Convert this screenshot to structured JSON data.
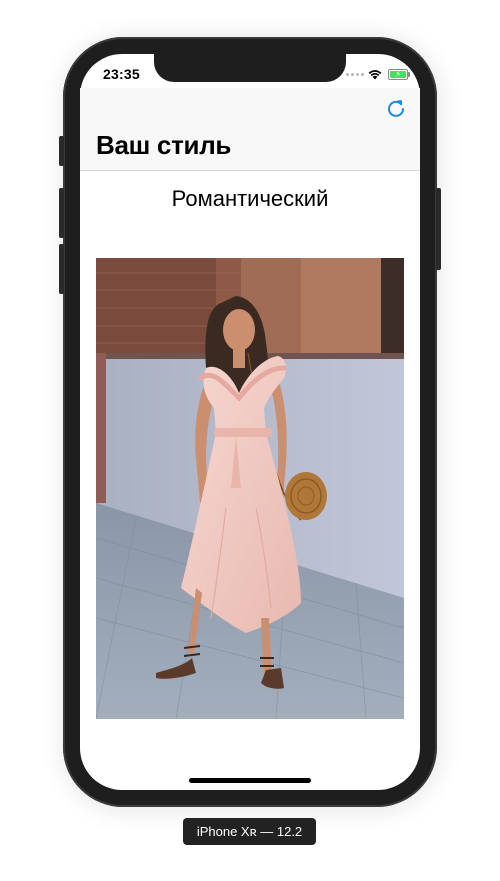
{
  "status_bar": {
    "time": "23:35"
  },
  "nav": {
    "title": "Ваш стиль",
    "refresh_icon": "refresh-icon"
  },
  "content": {
    "style_name": "Романтический",
    "photo_alt": "woman in pink wrap dress with round straw bag"
  },
  "device_label": "iPhone Xʀ — 12.2",
  "colors": {
    "accent": "#1e88e5",
    "navbar_bg": "#f8f8f8",
    "device": "#1e1e1e"
  }
}
